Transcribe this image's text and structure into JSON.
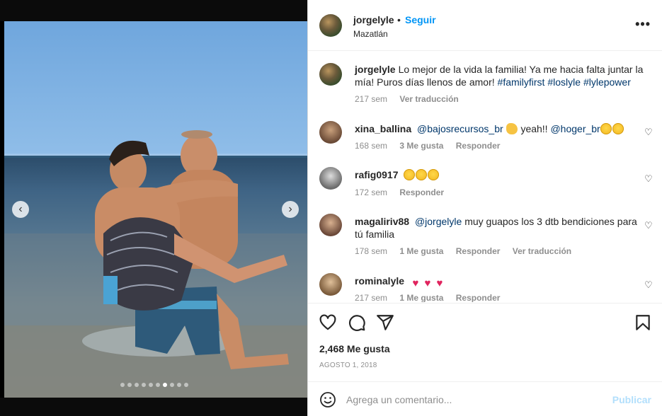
{
  "post": {
    "username": "jorgelyle",
    "separator": "•",
    "follow_label": "Seguir",
    "location": "Mazatlán",
    "more_label": "•••"
  },
  "caption": {
    "username": "jorgelyle",
    "text": "Lo mejor de la vida la familia! Ya me hacia falta juntar la mía! Puros días llenos de amor!",
    "hashtags": [
      "#familyfirst",
      "#loslyle",
      "#lylepower"
    ],
    "time": "217 sem",
    "translate": "Ver traducción"
  },
  "comments": [
    {
      "username": "xina_ballina",
      "mention1": "@bajosrecursos_br",
      "text": "yeah!!",
      "mention2": "@hoger_br",
      "time": "168 sem",
      "likes": "3 Me gusta",
      "reply": "Responder"
    },
    {
      "username": "rafig0917",
      "time": "172 sem",
      "reply": "Responder"
    },
    {
      "username": "magaliriv88",
      "mention": "@jorgelyle",
      "text": "muy guapos los 3 dtb bendiciones para tú familia",
      "time": "178 sem",
      "likes": "1 Me gusta",
      "reply": "Responder",
      "translate": "Ver traducción"
    },
    {
      "username": "rominalyle",
      "time": "217 sem",
      "likes": "1 Me gusta",
      "reply": "Responder"
    }
  ],
  "stats": {
    "likes": "2,468 Me gusta",
    "date": "AGOSTO 1, 2018"
  },
  "composer": {
    "placeholder": "Agrega un comentario...",
    "publish_label": "Publicar"
  },
  "carousel": {
    "prev": "‹",
    "next": "›",
    "slide_count": 10,
    "active_index": 6
  },
  "icons": {
    "like": "heart-icon",
    "comment": "comment-icon",
    "share": "share-icon",
    "save": "bookmark-icon",
    "emoji": "emoji-icon"
  },
  "colors": {
    "accent": "#0095f6",
    "hashtag": "#00376b",
    "muted": "#8e8e8e",
    "publish_disabled": "#b2dffc"
  }
}
